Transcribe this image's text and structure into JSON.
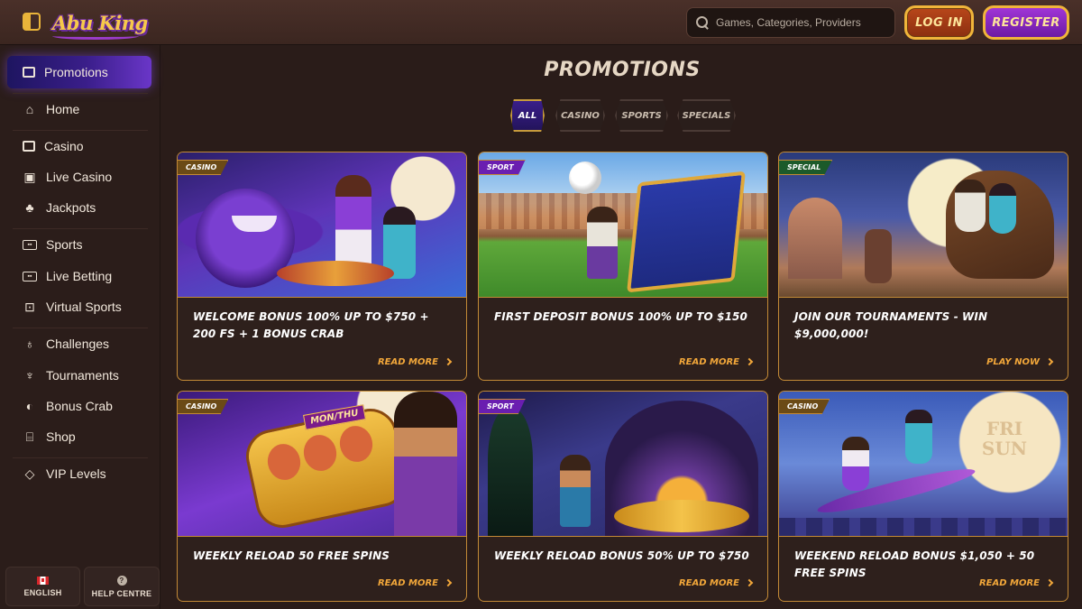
{
  "header": {
    "logo_text": "Abu King",
    "search_placeholder": "Games, Categories, Providers",
    "login_label": "LOG IN",
    "register_label": "REGISTER"
  },
  "sidebar": {
    "items": [
      {
        "label": "Promotions",
        "icon": "promotions-icon"
      },
      {
        "label": "Home",
        "icon": "home-icon"
      },
      {
        "label": "Casino",
        "icon": "casino-icon"
      },
      {
        "label": "Live Casino",
        "icon": "live-casino-icon"
      },
      {
        "label": "Jackpots",
        "icon": "jackpots-icon"
      },
      {
        "label": "Sports",
        "icon": "sports-icon"
      },
      {
        "label": "Live Betting",
        "icon": "live-betting-icon"
      },
      {
        "label": "Virtual Sports",
        "icon": "virtual-sports-icon"
      },
      {
        "label": "Challenges",
        "icon": "challenges-icon"
      },
      {
        "label": "Tournaments",
        "icon": "tournaments-icon"
      },
      {
        "label": "Bonus Crab",
        "icon": "bonus-crab-icon"
      },
      {
        "label": "Shop",
        "icon": "shop-icon"
      },
      {
        "label": "VIP Levels",
        "icon": "vip-icon"
      }
    ],
    "language_label": "ENGLISH",
    "help_label": "HELP CENTRE"
  },
  "main": {
    "title": "PROMOTIONS",
    "filters": [
      "ALL",
      "CASINO",
      "SPORTS",
      "SPECIALS"
    ],
    "cards": [
      {
        "badge": "CASINO",
        "title": "WELCOME BONUS 100% UP TO $750 + 200 FS + 1 BONUS CRAB",
        "cta": "READ MORE"
      },
      {
        "badge": "SPORT",
        "title": "FIRST DEPOSIT BONUS 100% UP TO $150",
        "cta": "READ MORE"
      },
      {
        "badge": "SPECIAL",
        "title": "JOIN OUR TOURNAMENTS - WIN $9,000,000!",
        "cta": "PLAY NOW"
      },
      {
        "badge": "CASINO",
        "title": "WEEKLY RELOAD 50 FREE SPINS",
        "cta": "READ MORE",
        "art_text": "MON/THU"
      },
      {
        "badge": "SPORT",
        "title": "WEEKLY RELOAD BONUS 50% UP TO $750",
        "cta": "READ MORE"
      },
      {
        "badge": "CASINO",
        "title": "WEEKEND RELOAD BONUS $1,050 + 50 FREE SPINS",
        "cta": "READ MORE",
        "art_text": "FRI SUN"
      }
    ]
  },
  "colors": {
    "background": "#2a1c19",
    "accent_gold": "#f2a73a",
    "active_purple": "#3a1e8a"
  }
}
